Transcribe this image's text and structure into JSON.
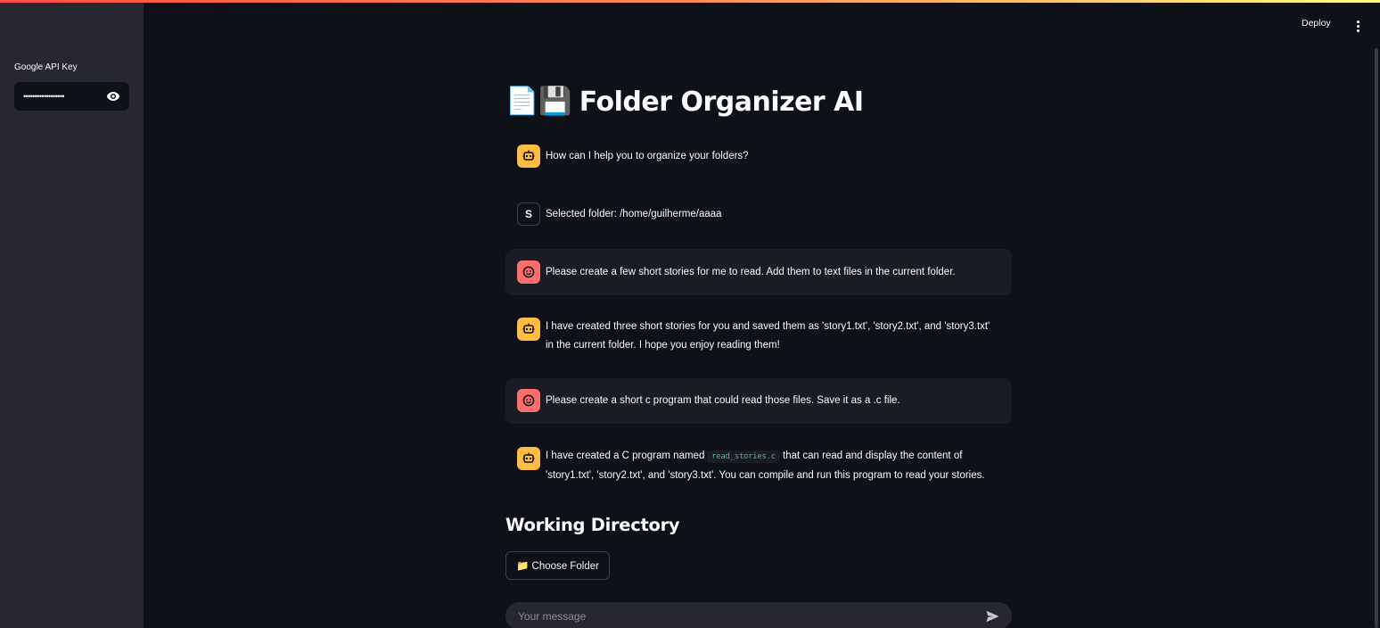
{
  "header": {
    "deploy_label": "Deploy"
  },
  "sidebar": {
    "api_key_label": "Google API Key",
    "api_key_value": "••••••••••••••••••"
  },
  "main": {
    "title_emoji": "📄💾",
    "title": "Folder Organizer AI",
    "messages": [
      {
        "role": "assistant",
        "text": "How can I help you to organize your folders?"
      },
      {
        "role": "system",
        "avatar_letter": "S",
        "text": "Selected folder: /home/guilherme/aaaa"
      },
      {
        "role": "user",
        "text": "Please create a few short stories for me to read. Add them to text files in the current folder."
      },
      {
        "role": "assistant",
        "line1": "I have created three short stories for you and saved them as 'story1.txt', 'story2.txt', and 'story3.txt'",
        "line2": "in the current folder. I hope you enjoy reading them!"
      },
      {
        "role": "user",
        "text": "Please create a short c program that could read those files. Save it as a .c file."
      },
      {
        "role": "assistant",
        "pre_code": "I have created a C program named",
        "code": "read_stories.c",
        "post_code": "that can read and display the content of",
        "line2": "'story1.txt', 'story2.txt', and 'story3.txt'. You can compile and run this program to read your stories."
      }
    ],
    "working_directory_heading": "Working Directory",
    "choose_folder_label": "📁 Choose Folder",
    "chat_placeholder": "Your message"
  },
  "colors": {
    "background": "#0e1117",
    "sidebar": "#262730",
    "assistant_avatar": "#ffbd45",
    "user_avatar": "#ff6c6c",
    "code_text": "#3fc380"
  },
  "icons": {
    "assistant_avatar": "robot-icon",
    "user_avatar": "smiley-face-icon",
    "password_toggle": "eye-icon",
    "menu": "kebab-menu-icon",
    "send": "send-arrow-icon"
  }
}
